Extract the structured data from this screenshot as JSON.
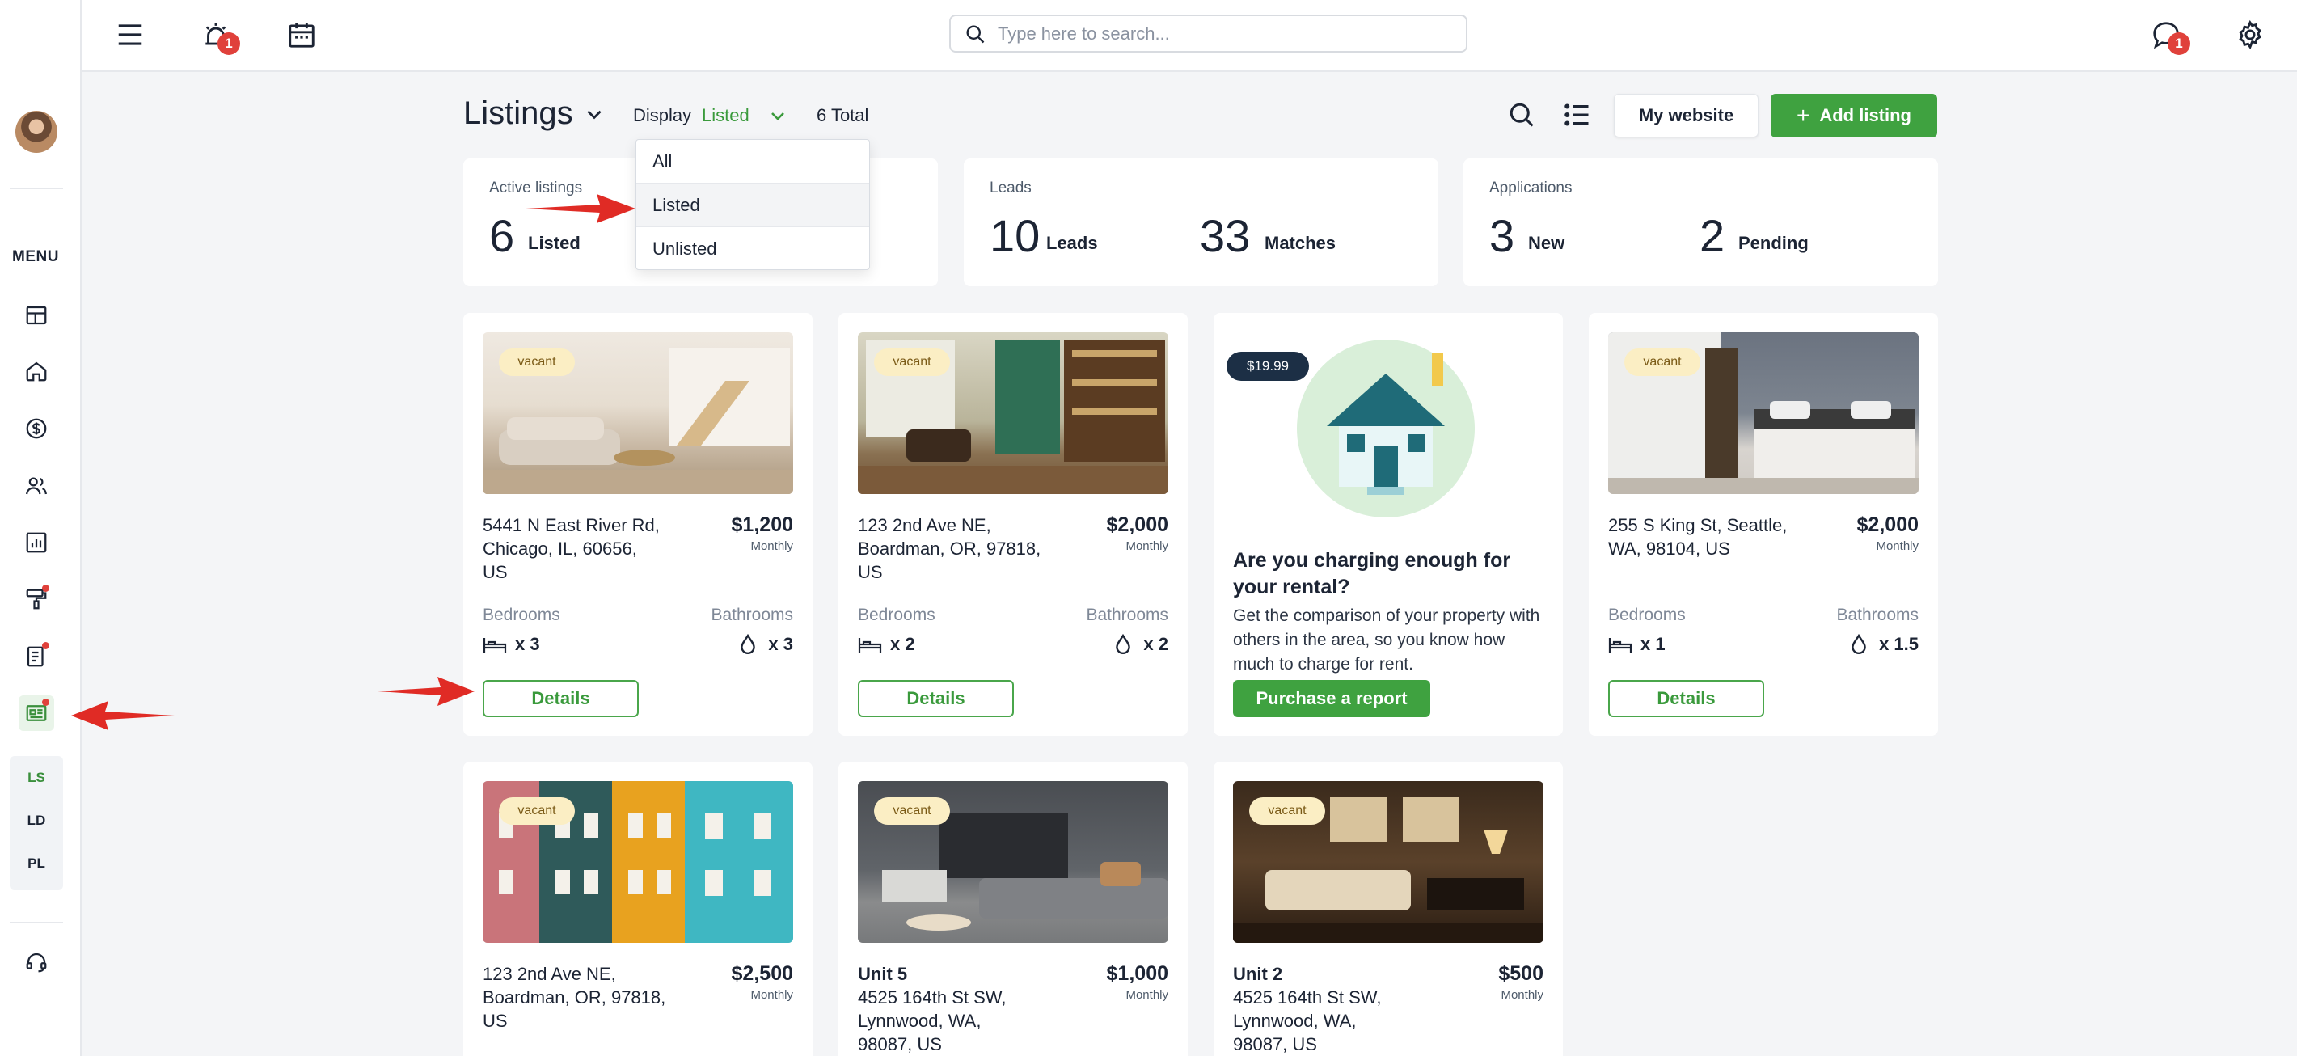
{
  "topbar": {
    "search_placeholder": "Type here to search...",
    "alerts_badge": "1",
    "chat_badge": "1"
  },
  "sidebar": {
    "menu_label": "MENU",
    "sub_items": [
      "LS",
      "LD",
      "PL"
    ]
  },
  "header": {
    "title": "Listings",
    "display_label": "Display",
    "display_value": "Listed",
    "total": "6 Total",
    "my_website": "My website",
    "add_listing": "Add listing"
  },
  "dropdown": {
    "options": [
      "All",
      "Listed",
      "Unlisted"
    ],
    "selected": "Listed"
  },
  "stats": {
    "active": {
      "label": "Active listings",
      "value": "6",
      "unit": "Listed"
    },
    "leads": {
      "label": "Leads",
      "value1": "10",
      "unit1": "Leads",
      "value2": "33",
      "unit2": "Matches"
    },
    "applications": {
      "label": "Applications",
      "value1": "3",
      "unit1": "New",
      "value2": "2",
      "unit2": "Pending"
    }
  },
  "labels": {
    "vacant": "vacant",
    "monthly": "Monthly",
    "bedrooms": "Bedrooms",
    "bathrooms": "Bathrooms",
    "details": "Details"
  },
  "listings": [
    {
      "address": [
        "5441 N East River Rd,",
        "Chicago, IL, 60656,",
        "US"
      ],
      "price": "$1,200",
      "beds": "x 3",
      "baths": "x 3"
    },
    {
      "address": [
        "123 2nd Ave NE,",
        "Boardman, OR, 97818,",
        "US"
      ],
      "price": "$2,000",
      "beds": "x 2",
      "baths": "x 2"
    },
    {
      "address": [
        "255 S King St, Seattle,",
        "WA, 98104, US"
      ],
      "price": "$2,000",
      "beds": "x 1",
      "baths": "x 1.5"
    },
    {
      "address": [
        "123 2nd Ave NE,",
        "Boardman, OR, 97818,",
        "US"
      ],
      "price": "$2,500"
    },
    {
      "unit": "Unit 5",
      "address": [
        "4525 164th St SW,",
        "Lynnwood, WA,",
        "98087, US"
      ],
      "price": "$1,000"
    },
    {
      "unit": "Unit 2",
      "address": [
        "4525 164th St SW,",
        "Lynnwood, WA,",
        "98087, US"
      ],
      "price": "$500"
    }
  ],
  "promo": {
    "price": "$19.99",
    "title": "Are you charging enough for your rental?",
    "text": "Get the comparison of your property with others in the area, so you know how much to charge for rent.",
    "button": "Purchase a report"
  },
  "colors": {
    "accent": "#3fa240",
    "badge": "#e0413b",
    "vacant_bg": "#fbeec4"
  }
}
